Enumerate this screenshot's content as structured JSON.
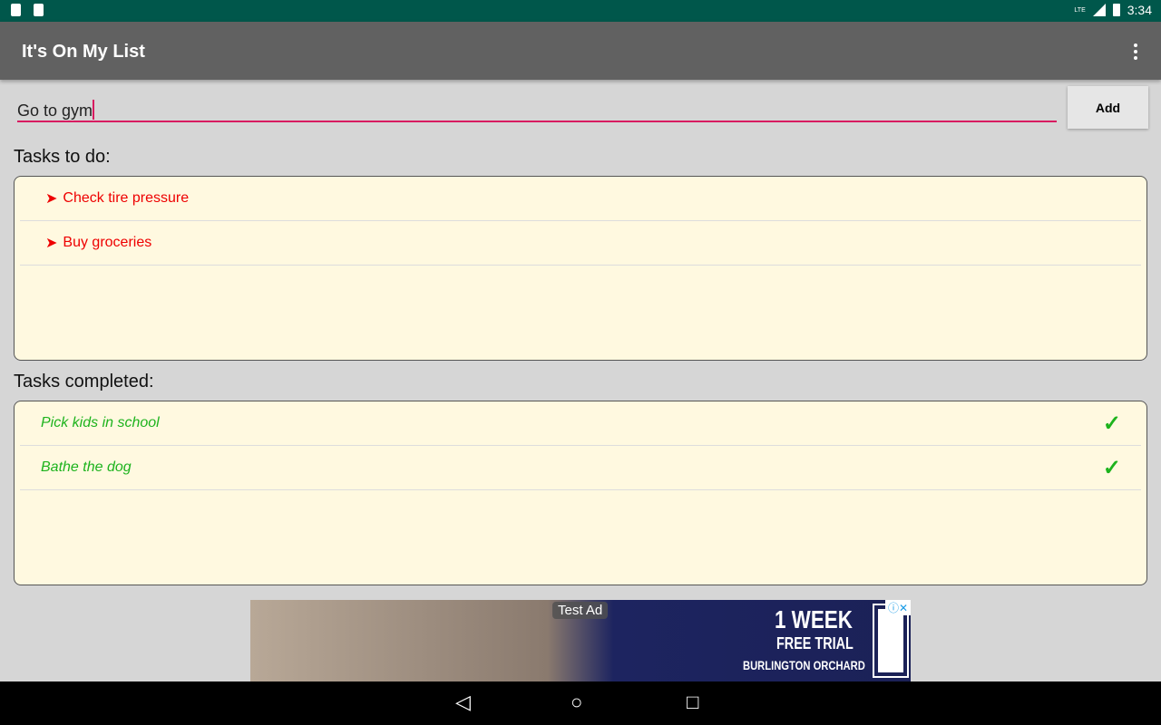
{
  "status": {
    "time": "3:34",
    "network": "LTE"
  },
  "appbar": {
    "title": "It's On My List"
  },
  "input": {
    "value": "Go to gym"
  },
  "add_label": "Add",
  "todo": {
    "heading": "Tasks to do:",
    "items": [
      {
        "label": "Check tire pressure"
      },
      {
        "label": "Buy groceries"
      }
    ]
  },
  "completed": {
    "heading": "Tasks completed:",
    "items": [
      {
        "label": "Pick kids in school"
      },
      {
        "label": "Bathe the dog"
      }
    ]
  },
  "ad": {
    "tag": "Test Ad",
    "line1": "1 WEEK",
    "line2": "FREE TRIAL",
    "line3": "BURLINGTON ORCHARD"
  },
  "colors": {
    "statusbar": "#00574b",
    "appbar": "#616161",
    "accent": "#d81b60",
    "todo": "#ee0000",
    "done": "#1db31d",
    "list_bg": "#fff9e0"
  }
}
